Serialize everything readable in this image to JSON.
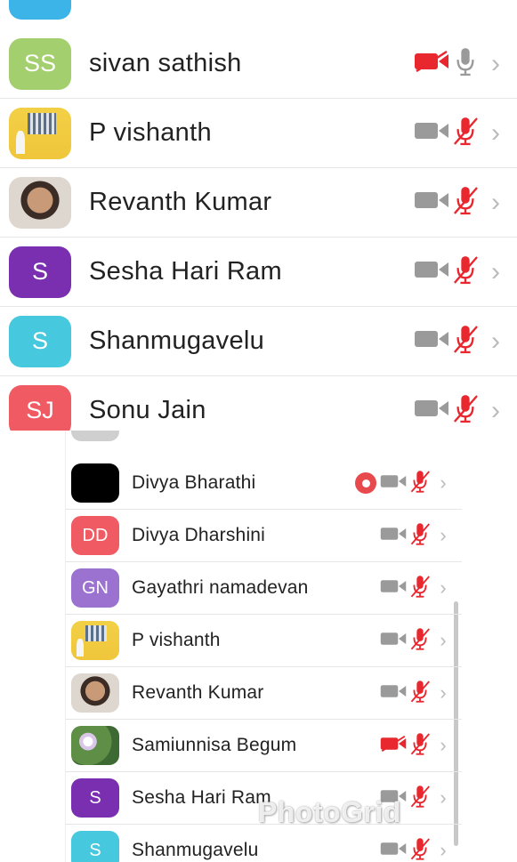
{
  "top_list": [
    {
      "initials": "SS",
      "name": "sivan sathish",
      "avatar_color": "#a3cf6e",
      "video_muted": true,
      "mic_muted": false
    },
    {
      "initials": "",
      "name": "P vishanth",
      "avatar_color": "",
      "photo": "photo1",
      "video_muted": false,
      "mic_muted": true
    },
    {
      "initials": "",
      "name": "Revanth Kumar",
      "avatar_color": "",
      "photo": "photo2",
      "video_muted": false,
      "mic_muted": true
    },
    {
      "initials": "S",
      "name": "Sesha Hari Ram",
      "avatar_color": "#7a2fb0",
      "video_muted": false,
      "mic_muted": true
    },
    {
      "initials": "S",
      "name": "Shanmugavelu",
      "avatar_color": "#46c8de",
      "video_muted": false,
      "mic_muted": true
    },
    {
      "initials": "SJ",
      "name": "Sonu Jain",
      "avatar_color": "#f05a63",
      "video_muted": false,
      "mic_muted": true
    }
  ],
  "bottom_list": [
    {
      "initials": "",
      "name": "Divya Bharathi",
      "avatar_color": "",
      "photo": "photo3",
      "video_muted": false,
      "mic_muted": true,
      "recording": true
    },
    {
      "initials": "DD",
      "name": "Divya Dharshini",
      "avatar_color": "#f05a63",
      "video_muted": false,
      "mic_muted": true
    },
    {
      "initials": "GN",
      "name": "Gayathri namadevan",
      "avatar_color": "#9b72cf",
      "video_muted": false,
      "mic_muted": true
    },
    {
      "initials": "",
      "name": "P vishanth",
      "avatar_color": "",
      "photo": "photo1",
      "video_muted": false,
      "mic_muted": true
    },
    {
      "initials": "",
      "name": "Revanth Kumar",
      "avatar_color": "",
      "photo": "photo2",
      "video_muted": false,
      "mic_muted": true
    },
    {
      "initials": "",
      "name": "Samiunnisa Begum",
      "avatar_color": "",
      "photo": "photo4",
      "video_muted": true,
      "mic_muted": true
    },
    {
      "initials": "S",
      "name": "Sesha Hari Ram",
      "avatar_color": "#7a2fb0",
      "video_muted": false,
      "mic_muted": true
    },
    {
      "initials": "S",
      "name": "Shanmugavelu",
      "avatar_color": "#46c8de",
      "video_muted": false,
      "mic_muted": true
    }
  ],
  "watermark": "PhotoGrid",
  "colors": {
    "muted_red": "#e8272f",
    "icon_gray": "#9a9a9a",
    "chevron": "#bbbbbb"
  }
}
